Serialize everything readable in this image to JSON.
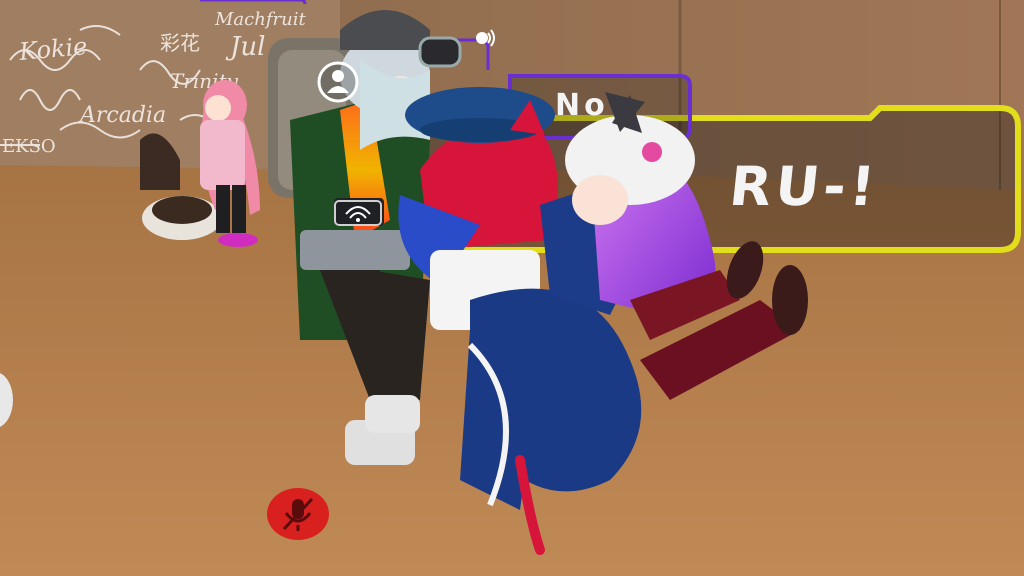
{
  "world": {
    "wall_scribbles": [
      "Kokie",
      "Machfruit",
      "Jul",
      "Arcadia",
      "EKSO",
      "Trinity",
      "彩花"
    ]
  },
  "nameplates": [
    {
      "id": "nameplate-yellow",
      "partial_text": "RU-!",
      "border_color": "#e2de1c"
    },
    {
      "id": "nameplate-purple",
      "partial_text": "No",
      "border_color": "#6a2fd0"
    }
  ],
  "hud": {
    "mute_icon": "muted-microphone-icon",
    "mute_color": "#d8201f",
    "voice_icon": "speaking-icon",
    "avatar_icon": "user-avatar-icon"
  },
  "colors": {
    "floor": "#b07a46",
    "wall": "#9c7450"
  }
}
